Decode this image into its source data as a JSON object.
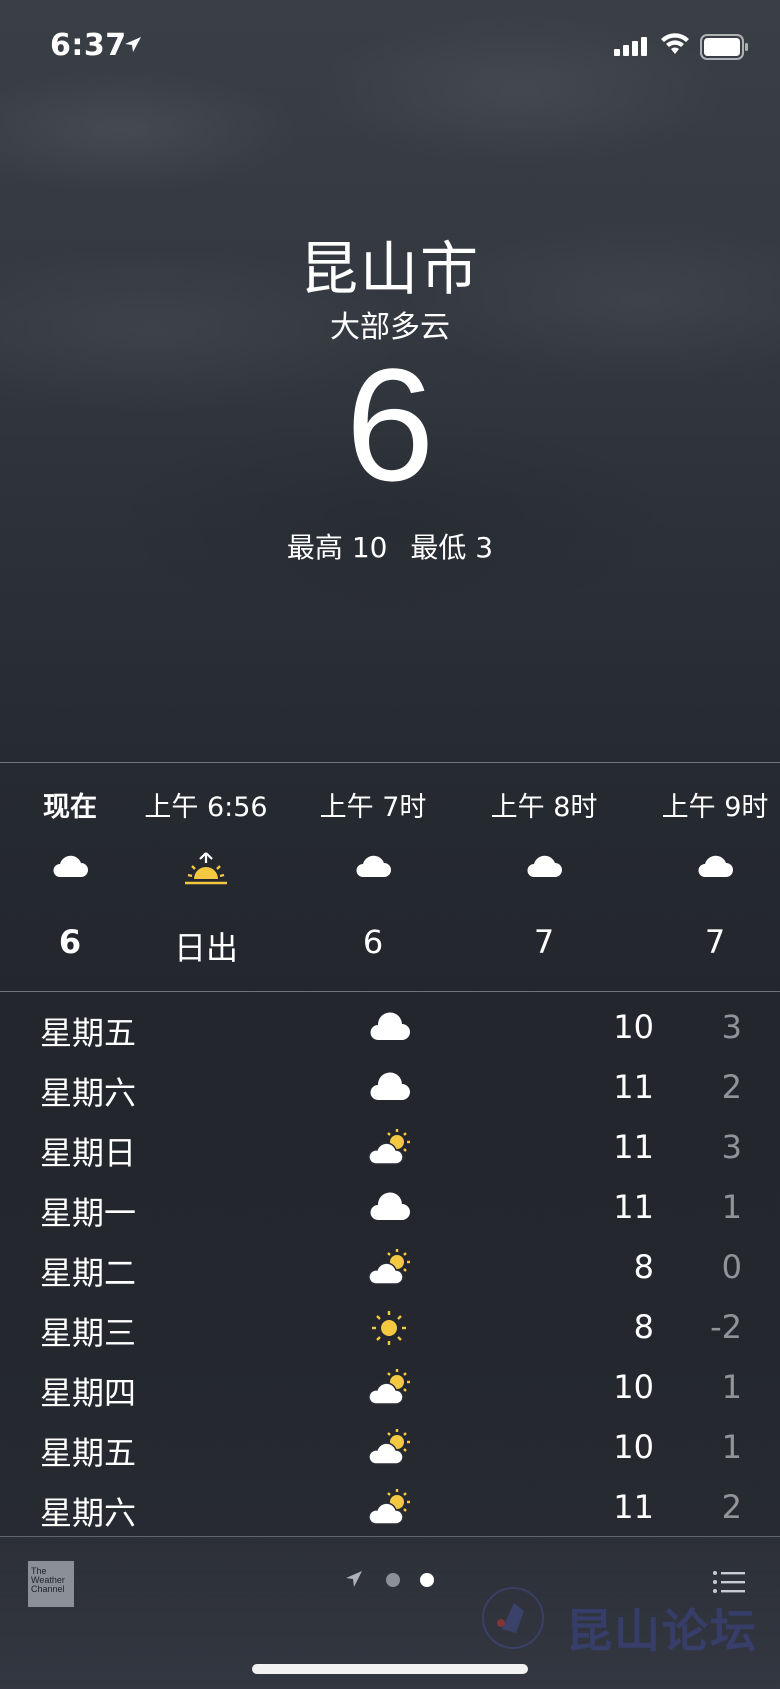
{
  "status": {
    "time": "6:37",
    "location_icon": "location-arrow-icon",
    "signal_icon": "cellular-signal-icon",
    "wifi_icon": "wifi-icon",
    "battery_icon": "battery-icon"
  },
  "weather": {
    "city": "昆山市",
    "condition": "大部多云",
    "temperature": "6",
    "high": "最高 10",
    "low": "最低 3"
  },
  "hourly": [
    {
      "label": "现在",
      "icon": "cloud-icon",
      "value": "6",
      "bold": true
    },
    {
      "label": "上午 6:56",
      "icon": "sunrise-icon",
      "value": "日出"
    },
    {
      "label": "上午 7时",
      "icon": "cloud-icon",
      "value": "6"
    },
    {
      "label": "上午 8时",
      "icon": "cloud-icon",
      "value": "7"
    },
    {
      "label": "上午 9时",
      "icon": "cloud-icon",
      "value": "7"
    }
  ],
  "daily": [
    {
      "day": "星期五",
      "icon": "cloud-icon",
      "high": "10",
      "low": "3"
    },
    {
      "day": "星期六",
      "icon": "cloud-icon",
      "high": "11",
      "low": "2"
    },
    {
      "day": "星期日",
      "icon": "partly-sunny-icon",
      "high": "11",
      "low": "3"
    },
    {
      "day": "星期一",
      "icon": "cloud-icon",
      "high": "11",
      "low": "1"
    },
    {
      "day": "星期二",
      "icon": "partly-sunny-icon",
      "high": "8",
      "low": "0"
    },
    {
      "day": "星期三",
      "icon": "sun-icon",
      "high": "8",
      "low": "-2"
    },
    {
      "day": "星期四",
      "icon": "partly-sunny-icon",
      "high": "10",
      "low": "1"
    },
    {
      "day": "星期五",
      "icon": "partly-sunny-icon",
      "high": "10",
      "low": "1"
    },
    {
      "day": "星期六",
      "icon": "partly-sunny-icon",
      "high": "11",
      "low": "2"
    }
  ],
  "bottom": {
    "logo_line1": "The",
    "logo_line2": "Weather",
    "logo_line3": "Channel",
    "watermark": "昆山论坛",
    "page_icons": [
      "location-arrow-icon",
      "page-dot-icon",
      "page-dot-active-icon"
    ],
    "list_icon": "list-icon"
  },
  "colors": {
    "sun": "#f5c842",
    "cloud": "#ffffff",
    "low_temp": "#9a9ca2"
  }
}
